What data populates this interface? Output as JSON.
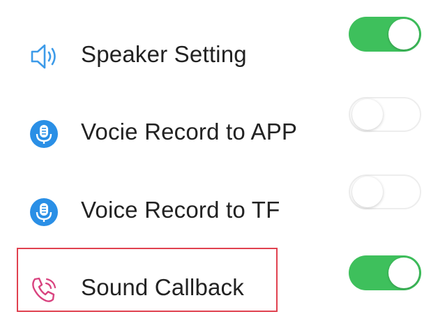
{
  "settings": [
    {
      "key": "speaker",
      "label": "Speaker Setting",
      "icon": "speaker-icon",
      "enabled": true
    },
    {
      "key": "record_app",
      "label": "Vocie Record to APP",
      "icon": "microphone-icon",
      "enabled": false
    },
    {
      "key": "record_tf",
      "label": "Voice Record to TF",
      "icon": "microphone-icon",
      "enabled": false
    },
    {
      "key": "sound_callback",
      "label": "Sound Callback",
      "icon": "phone-call-icon",
      "enabled": true
    }
  ],
  "highlighted": "sound_callback",
  "colors": {
    "toggle_on": "#3ec05c",
    "toggle_off_border": "#ededed",
    "icon_blue": "#2a8fe6",
    "speaker_blue": "#3d9be9",
    "callback_pink": "#d9437f",
    "highlight_red": "#e0414f"
  }
}
